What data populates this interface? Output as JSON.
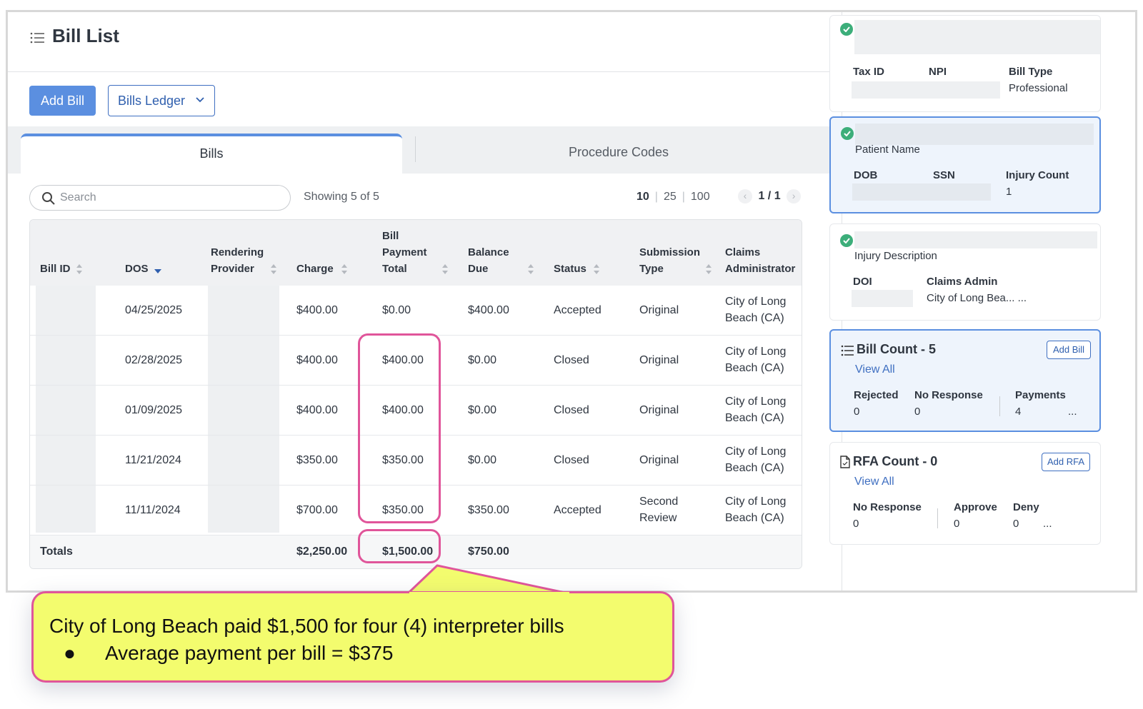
{
  "page": {
    "title": "Bill List",
    "add_bill": "Add Bill",
    "bills_ledger": "Bills Ledger"
  },
  "tabs": {
    "bills": "Bills",
    "procedure_codes": "Procedure Codes"
  },
  "toolbar": {
    "search_placeholder": "Search",
    "showing": "Showing 5 of 5",
    "page_sizes": [
      "10",
      "25",
      "100"
    ],
    "selected_page_size": "10",
    "pager": "1 / 1"
  },
  "table": {
    "headers": {
      "bill_id": "Bill ID",
      "dos": "DOS",
      "rendering_1": "Rendering",
      "rendering_2": "Provider",
      "charge": "Charge",
      "bpt_1": "Bill",
      "bpt_2": "Payment",
      "bpt_3": "Total",
      "balance_1": "Balance",
      "balance_2": "Due",
      "status": "Status",
      "submission_1": "Submission",
      "submission_2": "Type",
      "claims_1": "Claims",
      "claims_2": "Administrator"
    },
    "rows": [
      {
        "dos": "04/25/2025",
        "charge": "$400.00",
        "payment": "$0.00",
        "balance": "$400.00",
        "status": "Accepted",
        "sub1": "Original",
        "sub2": "",
        "admin1": "City of Long",
        "admin2": "Beach (CA)"
      },
      {
        "dos": "02/28/2025",
        "charge": "$400.00",
        "payment": "$400.00",
        "balance": "$0.00",
        "status": "Closed",
        "sub1": "Original",
        "sub2": "",
        "admin1": "City of Long",
        "admin2": "Beach (CA)"
      },
      {
        "dos": "01/09/2025",
        "charge": "$400.00",
        "payment": "$400.00",
        "balance": "$0.00",
        "status": "Closed",
        "sub1": "Original",
        "sub2": "",
        "admin1": "City of Long",
        "admin2": "Beach (CA)"
      },
      {
        "dos": "11/21/2024",
        "charge": "$350.00",
        "payment": "$350.00",
        "balance": "$0.00",
        "status": "Closed",
        "sub1": "Original",
        "sub2": "",
        "admin1": "City of Long",
        "admin2": "Beach (CA)"
      },
      {
        "dos": "11/11/2024",
        "charge": "$700.00",
        "payment": "$350.00",
        "balance": "$350.00",
        "status": "Accepted",
        "sub1": "Second",
        "sub2": "Review",
        "admin1": "City of Long",
        "admin2": "Beach (CA)"
      }
    ],
    "totals": {
      "label": "Totals",
      "charge": "$2,250.00",
      "payment": "$1,500.00",
      "balance": "$750.00"
    }
  },
  "sidebar": {
    "provider_card": {
      "tax_id": "Tax ID",
      "npi": "NPI",
      "bill_type_label": "Bill Type",
      "bill_type": "Professional"
    },
    "patient_card": {
      "patient_name": "Patient Name",
      "dob": "DOB",
      "ssn": "SSN",
      "injury_count_label": "Injury Count",
      "injury_count": "1"
    },
    "injury_card": {
      "injury_description": "Injury Description",
      "doi": "DOI",
      "claims_admin_label": "Claims Admin",
      "claims_admin": "City of Long Bea... ..."
    },
    "bill_count_card": {
      "title": "Bill Count - 5",
      "view_all": "View All",
      "add_button": "Add Bill",
      "rejected_label": "Rejected",
      "rejected": "0",
      "no_response_label": "No Response",
      "no_response": "0",
      "payments_label": "Payments",
      "payments": "4",
      "more": "..."
    },
    "rfa_card": {
      "title": "RFA Count - 0",
      "view_all": "View All",
      "add_button": "Add RFA",
      "no_response_label": "No Response",
      "no_response": "0",
      "approve_label": "Approve",
      "approve": "0",
      "deny_label": "Deny",
      "deny": "0",
      "more": "..."
    }
  },
  "callout": {
    "line1": "City of Long Beach paid $1,500 for four (4) interpreter bills",
    "bullet": "●",
    "line2": "Average payment per bill = $375"
  },
  "colors": {
    "primary": "#5b8fe0",
    "highlight": "#e0559a",
    "callout_bg": "#f3fc6e",
    "check": "#3cae7a"
  }
}
